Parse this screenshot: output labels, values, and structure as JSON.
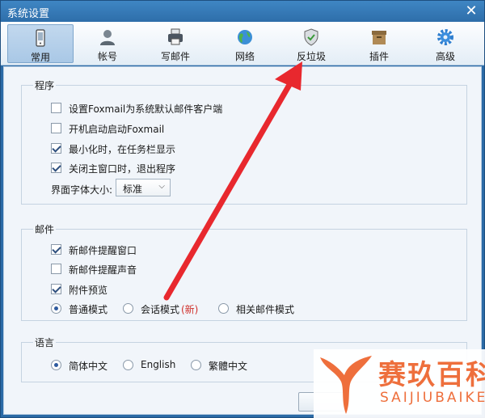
{
  "window": {
    "title": "系统设置"
  },
  "toolbar": {
    "items": [
      {
        "label": "常用",
        "icon": "phone-icon",
        "active": true
      },
      {
        "label": "帐号",
        "icon": "user-icon",
        "active": false
      },
      {
        "label": "写邮件",
        "icon": "printer-icon",
        "active": false
      },
      {
        "label": "网络",
        "icon": "globe-icon",
        "active": false
      },
      {
        "label": "反垃圾",
        "icon": "shield-icon",
        "active": false
      },
      {
        "label": "插件",
        "icon": "box-icon",
        "active": false
      },
      {
        "label": "高级",
        "icon": "gear-icon",
        "active": false
      }
    ]
  },
  "program": {
    "title": "程序",
    "options": [
      {
        "label": "设置Foxmail为系统默认邮件客户端",
        "checked": false
      },
      {
        "label": "开机启动启动Foxmail",
        "checked": false
      },
      {
        "label": "最小化时，在任务栏显示",
        "checked": true
      },
      {
        "label": "关闭主窗口时，退出程序",
        "checked": true
      }
    ],
    "font_size_label": "界面字体大小:",
    "font_size_value": "标准"
  },
  "mail": {
    "title": "邮件",
    "options": [
      {
        "label": "新邮件提醒窗口",
        "checked": true
      },
      {
        "label": "新邮件提醒声音",
        "checked": false
      },
      {
        "label": "附件预览",
        "checked": true
      }
    ],
    "modes": [
      {
        "label": "普通模式",
        "checked": true
      },
      {
        "label": "会话模式",
        "tag": "(新)",
        "checked": false
      },
      {
        "label": "相关邮件模式",
        "checked": false
      }
    ]
  },
  "language": {
    "title": "语言",
    "options": [
      {
        "label": "简体中文",
        "checked": true
      },
      {
        "label": "English",
        "checked": false
      },
      {
        "label": "繁體中文",
        "checked": false
      }
    ]
  },
  "watermark": {
    "cn": "赛玖百科",
    "en": "SAIJIUBAIKE"
  },
  "colors": {
    "accent": "#2b6aa6",
    "arrow": "#e8282e",
    "watermark": "#ee6f3c"
  }
}
